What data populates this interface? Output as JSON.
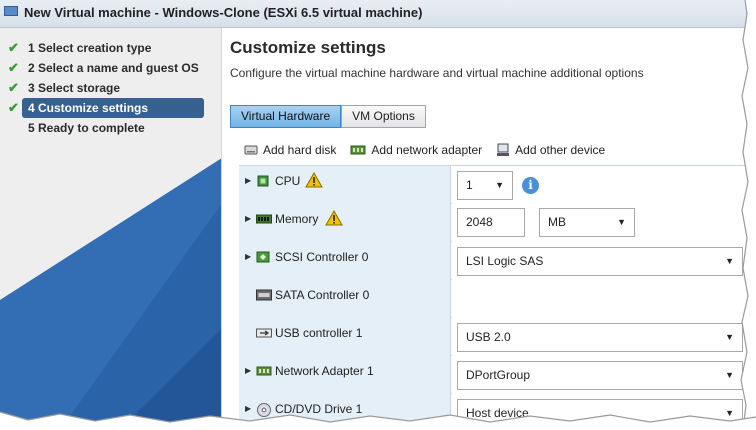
{
  "window": {
    "title": "New Virtual machine - Windows-Clone (ESXi 6.5 virtual machine)"
  },
  "wizard": {
    "steps": [
      {
        "label": "1 Select creation type",
        "done": true
      },
      {
        "label": "2 Select a name and guest OS",
        "done": true
      },
      {
        "label": "3 Select storage",
        "done": true
      },
      {
        "label": "4 Customize settings",
        "done": true,
        "active": true
      },
      {
        "label": "5 Ready to complete",
        "done": false
      }
    ],
    "check_glyph": "✔"
  },
  "main": {
    "title": "Customize settings",
    "description": "Configure the virtual machine hardware and virtual machine additional options",
    "tabs": [
      {
        "label": "Virtual Hardware",
        "active": true
      },
      {
        "label": "VM Options",
        "active": false
      }
    ],
    "toolbar": {
      "add_hard_disk": "Add hard disk",
      "add_network_adapter": "Add network adapter",
      "add_other_device": "Add other device"
    }
  },
  "hardware": {
    "cpu": {
      "label": "CPU",
      "value": "1",
      "warning": true
    },
    "memory": {
      "label": "Memory",
      "value": "2048",
      "unit": "MB",
      "warning": true
    },
    "scsi": {
      "label": "SCSI Controller 0",
      "value": "LSI Logic SAS"
    },
    "sata": {
      "label": "SATA Controller 0"
    },
    "usb": {
      "label": "USB controller 1",
      "value": "USB 2.0"
    },
    "network": {
      "label": "Network Adapter 1",
      "value": "DPortGroup"
    },
    "cdrom": {
      "label": "CD/DVD Drive 1",
      "value": "Host device"
    }
  },
  "colors": {
    "accent": "#35608f",
    "tab_active": "#74b4e6",
    "label_bg": "#e5eff7",
    "check": "#3b9c3b",
    "warning": "#f2c200",
    "info": "#4a90d9"
  }
}
